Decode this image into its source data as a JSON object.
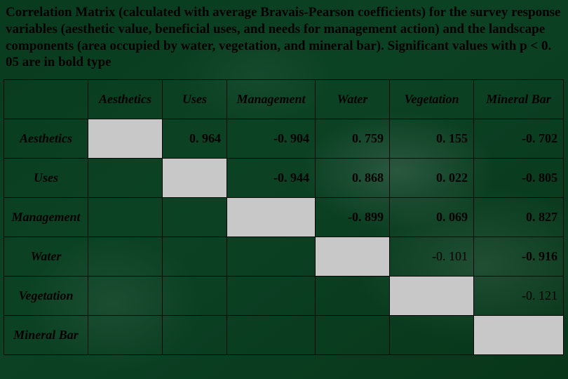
{
  "caption": "Correlation Matrix (calculated with average Bravais-Pearson coefficients) for the survey response variables (aesthetic value, beneficial uses, and needs for management action) and the landscape components (area occupied by water, vegetation, and mineral bar). Significant values with p < 0. 05 are in bold type",
  "headers": {
    "col1": "Aesthetics",
    "col2": "Uses",
    "col3": "Management",
    "col4": "Water",
    "col5": "Vegetation",
    "col6": "Mineral Bar"
  },
  "rows": {
    "r1": {
      "label": "Aesthetics",
      "v2": "0. 964",
      "v3": "-0. 904",
      "v4": "0. 759",
      "v5": "0. 155",
      "v6": "-0. 702"
    },
    "r2": {
      "label": "Uses",
      "v3": "-0. 944",
      "v4": "0. 868",
      "v5": "0. 022",
      "v6": "-0. 805"
    },
    "r3": {
      "label": "Management",
      "v4": "-0. 899",
      "v5": "0. 069",
      "v6": "0. 827"
    },
    "r4": {
      "label": "Water",
      "v5": "-0. 101",
      "v6": "-0. 916"
    },
    "r5": {
      "label": "Vegetation",
      "v6": "-0. 121"
    },
    "r6": {
      "label": "Mineral Bar"
    }
  },
  "chart_data": {
    "type": "table",
    "title": "Correlation Matrix (Bravais-Pearson coefficients)",
    "variables": [
      "Aesthetics",
      "Uses",
      "Management",
      "Water",
      "Vegetation",
      "Mineral Bar"
    ],
    "significance_note": "Significant values with p < 0.05 are in bold type",
    "matrix_upper": [
      [
        null,
        0.964,
        -0.904,
        0.759,
        0.155,
        -0.702
      ],
      [
        null,
        null,
        -0.944,
        0.868,
        0.022,
        -0.805
      ],
      [
        null,
        null,
        null,
        -0.899,
        0.069,
        0.827
      ],
      [
        null,
        null,
        null,
        null,
        -0.101,
        -0.916
      ],
      [
        null,
        null,
        null,
        null,
        null,
        -0.121
      ],
      [
        null,
        null,
        null,
        null,
        null,
        null
      ]
    ],
    "significant_mask_upper": [
      [
        null,
        true,
        true,
        true,
        true,
        true
      ],
      [
        null,
        null,
        true,
        true,
        true,
        true
      ],
      [
        null,
        null,
        null,
        true,
        true,
        true
      ],
      [
        null,
        null,
        null,
        null,
        false,
        true
      ],
      [
        null,
        null,
        null,
        null,
        null,
        false
      ],
      [
        null,
        null,
        null,
        null,
        null,
        null
      ]
    ]
  }
}
